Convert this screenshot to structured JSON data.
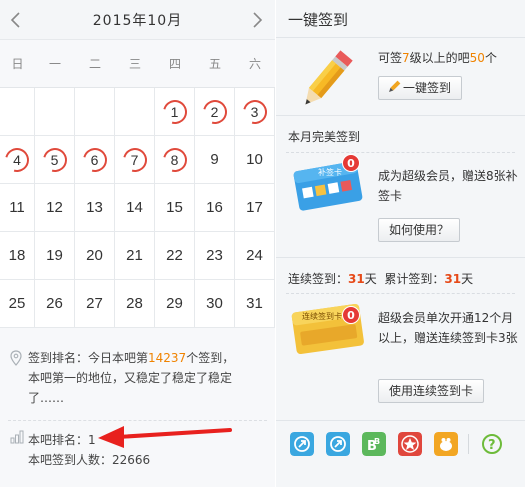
{
  "calendar": {
    "month_title": "2015年10月",
    "weekdays": [
      "日",
      "一",
      "二",
      "三",
      "四",
      "五",
      "六"
    ],
    "weeks": [
      [
        "",
        "",
        "",
        "",
        "1",
        "2",
        "3"
      ],
      [
        "4",
        "5",
        "6",
        "7",
        "8",
        "9",
        "10"
      ],
      [
        "11",
        "12",
        "13",
        "14",
        "15",
        "16",
        "17"
      ],
      [
        "18",
        "19",
        "20",
        "21",
        "22",
        "23",
        "24"
      ],
      [
        "25",
        "26",
        "27",
        "28",
        "29",
        "30",
        "31"
      ]
    ],
    "signed_days": [
      "1",
      "2",
      "3",
      "4",
      "5",
      "6",
      "7",
      "8"
    ]
  },
  "rank_info": {
    "line_prefix": "签到排名：今日本吧第",
    "rank_number": "14237",
    "line_suffix": "个签到，",
    "line2": "本吧第一的地位，又稳定了稳定了稳定",
    "line3": "了……",
    "bar_rank": "本吧排名：1",
    "bar_count": "本吧签到人数：22666"
  },
  "one_click": {
    "title": "一键签到",
    "desc_prefix": "可签",
    "level": "7",
    "desc_mid": "级以上的吧",
    "count": "50",
    "desc_suffix": "个",
    "button_label": "一键签到"
  },
  "perfect": {
    "title": "本月完美签到",
    "card_label": "补签卡",
    "badge": "0",
    "desc": "成为超级会员，赠送8张补签卡",
    "button_label": "如何使用？"
  },
  "streak": {
    "prefix": "连续签到：",
    "streak_days": "31",
    "unit1": "天",
    "total_prefix": "累计签到：",
    "total_days": "31",
    "unit2": "天",
    "card_label": "连续签到卡",
    "badge": "0",
    "desc": "超级会员单次开通12个月以上，赠送连续签到卡3张",
    "button_label": "使用连续签到卡"
  },
  "app_icons": [
    "share-icon-1",
    "share-icon-2",
    "bb-icon",
    "star-badge-icon",
    "crab-icon",
    "help-icon"
  ],
  "colors": {
    "accent_orange": "#f08300",
    "ring_red": "#e04a3c",
    "bar_red": "#e64a19"
  }
}
